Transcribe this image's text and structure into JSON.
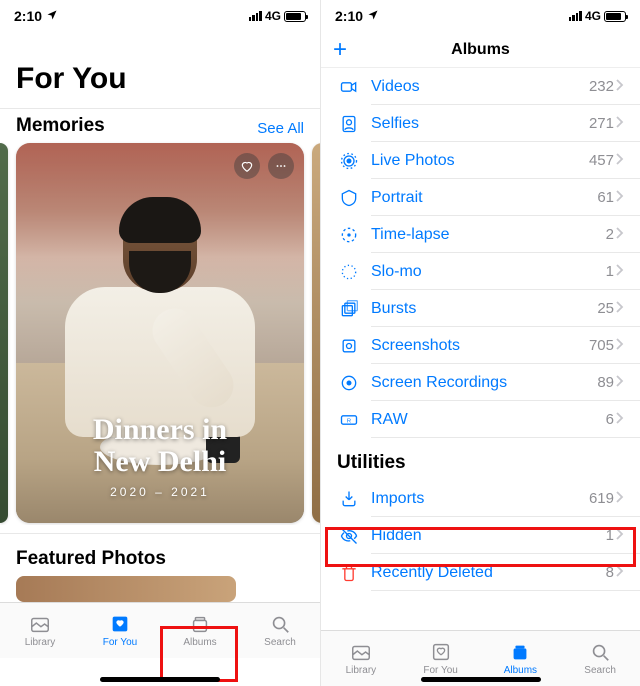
{
  "status": {
    "time": "2:10",
    "network": "4G"
  },
  "left": {
    "title": "For You",
    "memories": {
      "header": "Memories",
      "see_all": "See All",
      "card": {
        "title_line1": "Dinners in",
        "title_line2": "New Delhi",
        "subtitle": "2020 – 2021"
      }
    },
    "featured_header": "Featured Photos",
    "tabs": {
      "library": "Library",
      "for_you": "For You",
      "albums": "Albums",
      "search": "Search",
      "active": "for_you"
    }
  },
  "right": {
    "header": {
      "title": "Albums",
      "add_icon": "plus-icon"
    },
    "media_types": [
      {
        "icon": "video-icon",
        "label": "Videos",
        "count": "232"
      },
      {
        "icon": "selfie-icon",
        "label": "Selfies",
        "count": "271"
      },
      {
        "icon": "livephoto-icon",
        "label": "Live Photos",
        "count": "457"
      },
      {
        "icon": "portrait-icon",
        "label": "Portrait",
        "count": "61"
      },
      {
        "icon": "timelapse-icon",
        "label": "Time-lapse",
        "count": "2"
      },
      {
        "icon": "slomo-icon",
        "label": "Slo-mo",
        "count": "1"
      },
      {
        "icon": "bursts-icon",
        "label": "Bursts",
        "count": "25"
      },
      {
        "icon": "screenshot-icon",
        "label": "Screenshots",
        "count": "705"
      },
      {
        "icon": "screenrec-icon",
        "label": "Screen Recordings",
        "count": "89"
      },
      {
        "icon": "raw-icon",
        "label": "RAW",
        "count": "6"
      }
    ],
    "utilities_header": "Utilities",
    "utilities": [
      {
        "icon": "imports-icon",
        "label": "Imports",
        "count": "619"
      },
      {
        "icon": "hidden-icon",
        "label": "Hidden",
        "count": "1"
      },
      {
        "icon": "trash-icon",
        "label": "Recently Deleted",
        "count": "8"
      }
    ],
    "tabs": {
      "library": "Library",
      "for_you": "For You",
      "albums": "Albums",
      "search": "Search",
      "active": "albums"
    }
  }
}
